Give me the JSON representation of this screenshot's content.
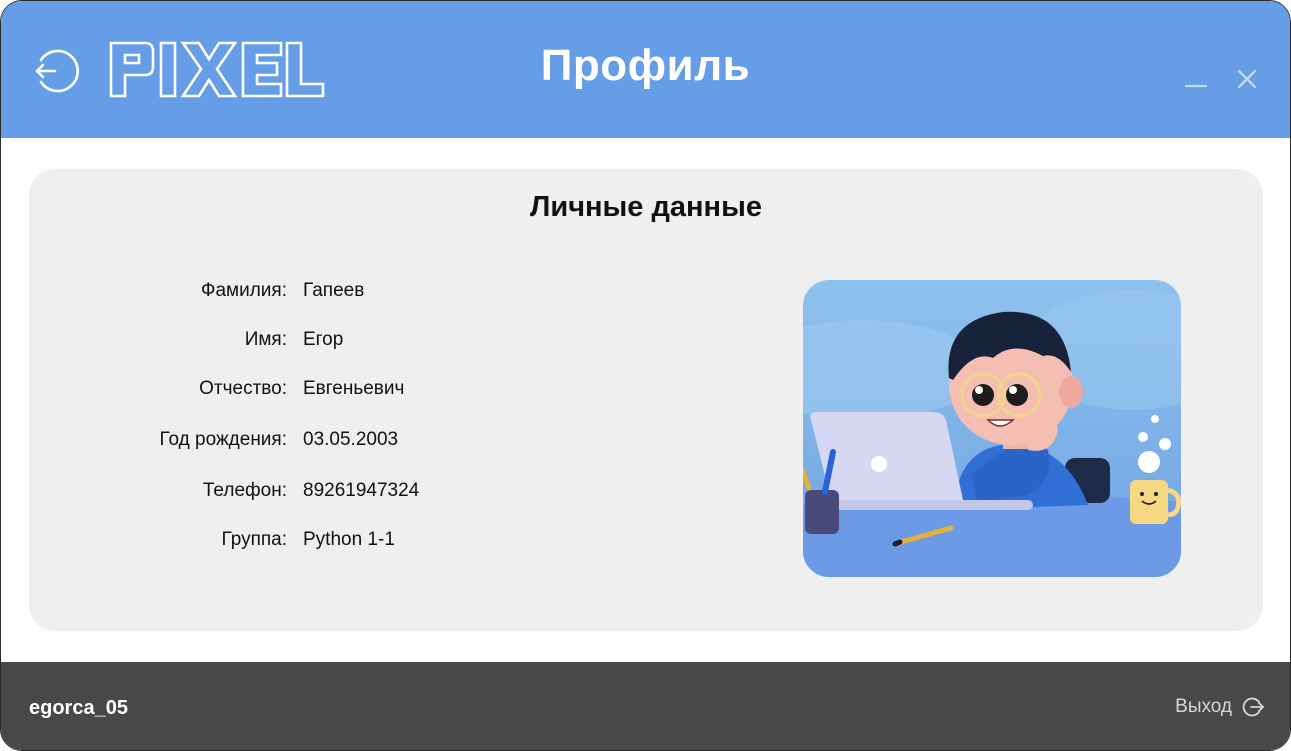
{
  "header": {
    "title": "Профиль",
    "logo_text": "PIXEL",
    "back_icon": "back-arrow-icon",
    "minimize_icon": "minimize-icon",
    "close_icon": "close-icon",
    "color": "#659de6"
  },
  "profile": {
    "section_title": "Личные данные",
    "fields": [
      {
        "label": "Фамилия:",
        "value": "Гапеев"
      },
      {
        "label": "Имя:",
        "value": "Егор"
      },
      {
        "label": "Отчество:",
        "value": "Евгеньевич"
      },
      {
        "label": "Год рождения:",
        "value": "03.05.2003"
      },
      {
        "label": "Телефон:",
        "value": "89261947324"
      },
      {
        "label": "Группа:",
        "value": "Python 1-1"
      }
    ],
    "avatar": "boy-with-laptop-illustration"
  },
  "footer": {
    "username": "egorca_05",
    "logout_label": "Выход",
    "logout_icon": "logout-icon",
    "color": "#484848"
  }
}
